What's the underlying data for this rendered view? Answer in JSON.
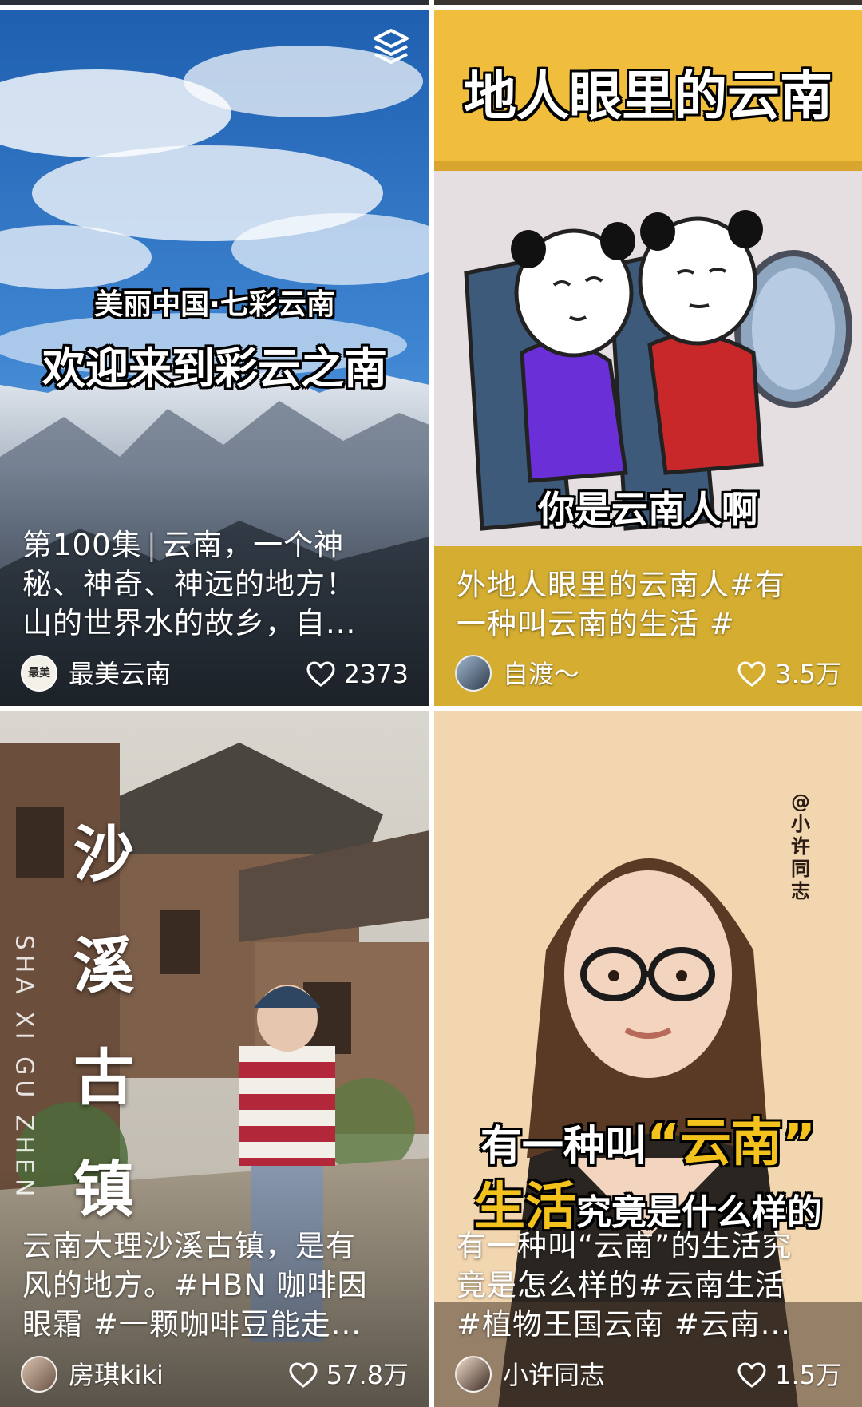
{
  "cards": [
    {
      "overlay_line1": "美丽中国·七彩云南",
      "overlay_line2": "欢迎来到彩云之南",
      "desc_prefix": "第100集",
      "desc_body_1": "云南，一个神",
      "desc_line2": "秘、神奇、神远的地方！",
      "desc_line3": "山的世界水的故乡，自...",
      "author": "最美云南",
      "avatar_text": "最美",
      "likes": "2373",
      "has_collection_icon": true
    },
    {
      "overlay_top": "地人眼里的云南",
      "overlay_caption": "你是云南人啊",
      "desc_line1": "外地人眼里的云南人#有",
      "desc_line2": "一种叫云南的生活 #",
      "author": "自渡～",
      "likes": "3.5万"
    },
    {
      "overlay_vertical": [
        "沙",
        "溪",
        "古",
        "镇"
      ],
      "overlay_pinyin": "SHA XI GU ZHEN",
      "desc_line1": "云南大理沙溪古镇，是有",
      "desc_line2": "风的地方。#HBN 咖啡因",
      "desc_line3": "眼霜 #一颗咖啡豆能走...",
      "author": "房琪kiki",
      "likes": "57.8万"
    },
    {
      "overlay_handle": "@小许同志",
      "overlay_line1": "有一种叫",
      "overlay_quote": "“云南”",
      "overlay_line2_big": "生活",
      "overlay_line2_rest": "究竟是什么样的",
      "desc_line1": "有一种叫“云南”的生活究",
      "desc_line2": "竟是怎么样的#云南生活",
      "desc_line3": "#植物王国云南 #云南...",
      "author": "小许同志",
      "likes": "1.5万"
    }
  ]
}
